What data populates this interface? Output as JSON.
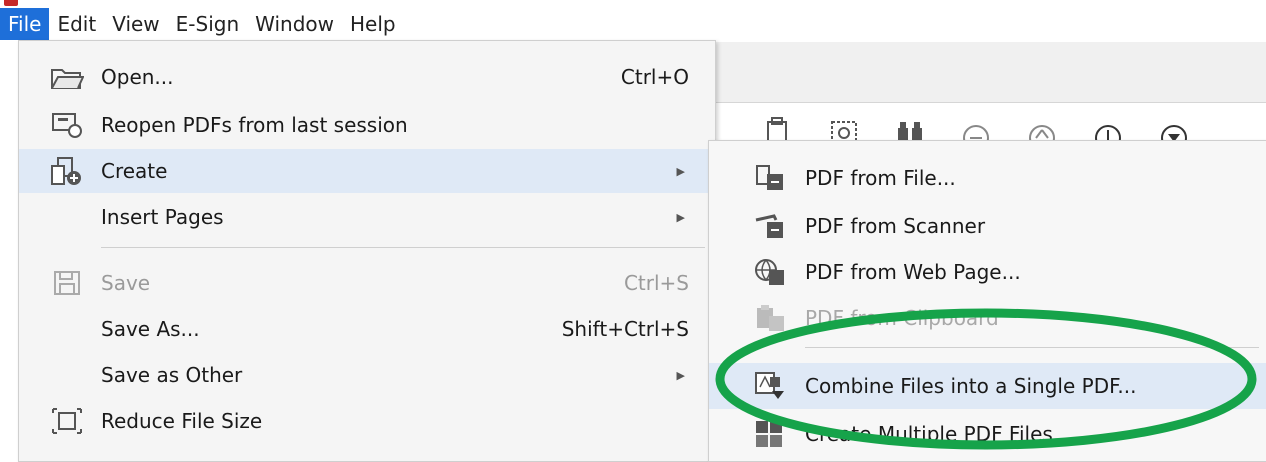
{
  "menubar": {
    "items": [
      "File",
      "Edit",
      "View",
      "E-Sign",
      "Window",
      "Help"
    ],
    "active": "File"
  },
  "file_menu": {
    "open": {
      "label": "Open...",
      "shortcut": "Ctrl+O",
      "icon": "folder-open-icon"
    },
    "reopen": {
      "label": "Reopen PDFs from last session",
      "icon": "reopen-session-icon"
    },
    "create": {
      "label": "Create",
      "icon": "create-pdf-icon"
    },
    "insert_pages": {
      "label": "Insert Pages"
    },
    "save": {
      "label": "Save",
      "shortcut": "Ctrl+S",
      "icon": "floppy-disk-icon"
    },
    "save_as": {
      "label": "Save As...",
      "shortcut": "Shift+Ctrl+S"
    },
    "save_as_other": {
      "label": "Save as Other"
    },
    "reduce_file_size": {
      "label": "Reduce File Size",
      "icon": "reduce-size-icon"
    }
  },
  "create_submenu": {
    "from_file": {
      "label": "PDF from File...",
      "icon": "pdf-from-file-icon"
    },
    "from_scanner": {
      "label": "PDF from Scanner",
      "icon": "scanner-icon"
    },
    "from_web": {
      "label": "PDF from Web Page...",
      "icon": "globe-icon"
    },
    "from_clipboard": {
      "label": "PDF from Clipboard",
      "icon": "clipboard-icon"
    },
    "combine": {
      "label": "Combine Files into a Single PDF...",
      "icon": "combine-files-icon"
    },
    "multiple": {
      "label": "Create Multiple PDF Files...",
      "icon": "multiple-pdf-icon"
    }
  },
  "colors": {
    "accent": "#1e6fd9",
    "highlight": "#dfe9f6",
    "annotation": "#16a34a"
  }
}
